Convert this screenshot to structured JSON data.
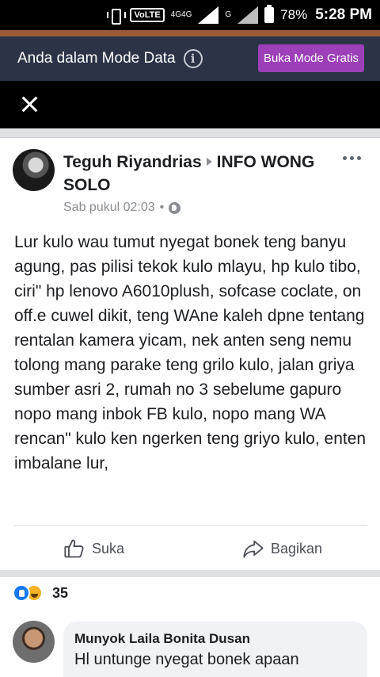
{
  "status_bar": {
    "volte": "VoLTE",
    "network_top": "4G",
    "network_bottom": "4G",
    "network_secondary": "G",
    "battery": "78%",
    "time": "5:28 PM"
  },
  "data_mode_banner": {
    "text": "Anda dalam Mode Data",
    "button_label": "Buka Mode Gratis"
  },
  "post": {
    "author": "Teguh Riyandrias",
    "group": "INFO WONG SOLO",
    "time": "Sab pukul 02:03",
    "separator": "•",
    "body": "Lur kulo wau tumut nyegat bonek teng banyu agung, pas pilisi tekok kulo mlayu, hp kulo tibo, ciri\" hp lenovo A6010plush, sofcase coclate, on off.e cuwel dikit, teng WAne kaleh dpne tentang rentalan kamera yicam, nek anten seng nemu tolong mang parake teng grilo kulo, jalan griya sumber asri 2, rumah no 3 sebelume gapuro nopo mang inbok FB kulo, nopo mang WA rencan\" kulo ken ngerken teng griyo kulo, enten imbalane lur,",
    "like_label": "Suka",
    "share_label": "Bagikan",
    "reaction_count": "35"
  },
  "comment": {
    "author": "Munyok Laila Bonita Dusan",
    "text": "Hl untunge nyegat bonek apaan"
  },
  "colors": {
    "banner_bg": "#2b3447",
    "button_bg": "#9c3fb8",
    "like_blue": "#1877f2",
    "haha_yellow": "#f7b125"
  }
}
